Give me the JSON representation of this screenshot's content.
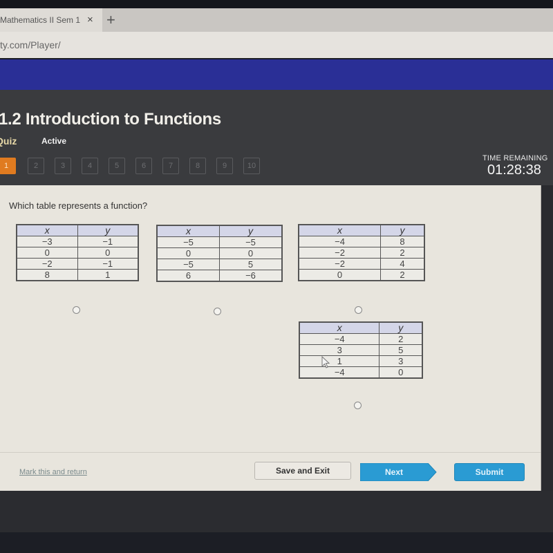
{
  "browser": {
    "tab_title": "Mathematics II Sem 1",
    "tab_close_icon": "×",
    "new_tab_icon": "+",
    "url": "ty.com/Player/"
  },
  "header": {
    "title": "1.2 Introduction to Functions",
    "type_label": "Quiz",
    "status": "Active",
    "question_nav": [
      "1",
      "2",
      "3",
      "4",
      "5",
      "6",
      "7",
      "8",
      "9",
      "10"
    ],
    "current_question": 1,
    "time_remaining_label": "TIME REMAINING",
    "time_remaining_value": "01:28:38"
  },
  "question": {
    "prompt": "Which table represents a function?",
    "options": [
      {
        "headers": [
          "x",
          "y"
        ],
        "rows": [
          [
            "−3",
            "−1"
          ],
          [
            "0",
            "0"
          ],
          [
            "−2",
            "−1"
          ],
          [
            "8",
            "1"
          ]
        ],
        "selected": false
      },
      {
        "headers": [
          "x",
          "y"
        ],
        "rows": [
          [
            "−5",
            "−5"
          ],
          [
            "0",
            "0"
          ],
          [
            "−5",
            "5"
          ],
          [
            "6",
            "−6"
          ]
        ],
        "selected": false
      },
      {
        "headers": [
          "x",
          "y"
        ],
        "rows": [
          [
            "−4",
            "8"
          ],
          [
            "−2",
            "2"
          ],
          [
            "−2",
            "4"
          ],
          [
            "0",
            "2"
          ]
        ],
        "selected": false
      },
      {
        "headers": [
          "x",
          "y"
        ],
        "rows": [
          [
            "−4",
            "2"
          ],
          [
            "3",
            "5"
          ],
          [
            "1",
            "3"
          ],
          [
            "−4",
            "0"
          ]
        ],
        "selected": false
      }
    ]
  },
  "footer": {
    "mark_link": "Mark this and return",
    "save_label": "Save and Exit",
    "next_label": "Next",
    "submit_label": "Submit"
  },
  "colors": {
    "brand_bar": "#2a2f96",
    "current_question": "#e07b20",
    "primary_button": "#2a9bd3"
  }
}
